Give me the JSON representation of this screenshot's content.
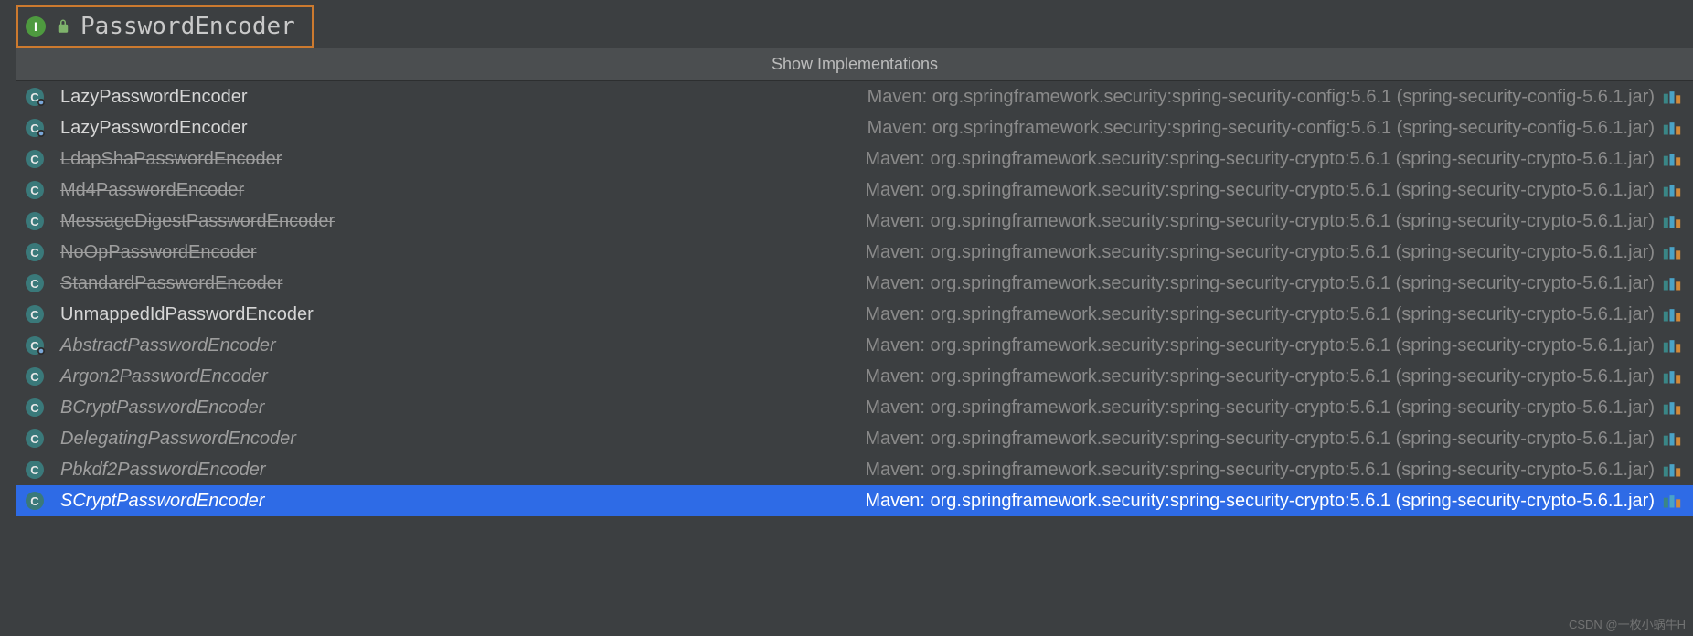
{
  "header": {
    "interface_name": "PasswordEncoder"
  },
  "popup": {
    "title": "Show Implementations"
  },
  "locations": {
    "config": "Maven: org.springframework.security:spring-security-config:5.6.1 (spring-security-config-5.6.1.jar)",
    "crypto": "Maven: org.springframework.security:spring-security-crypto:5.6.1 (spring-security-crypto-5.6.1.jar)"
  },
  "items": [
    {
      "name": "LazyPasswordEncoder",
      "style": "normal",
      "loc": "config",
      "selected": false,
      "overlay": true
    },
    {
      "name": "LazyPasswordEncoder",
      "style": "normal",
      "loc": "config",
      "selected": false,
      "overlay": true
    },
    {
      "name": "LdapShaPasswordEncoder",
      "style": "strike",
      "loc": "crypto",
      "selected": false,
      "overlay": false
    },
    {
      "name": "Md4PasswordEncoder",
      "style": "strike",
      "loc": "crypto",
      "selected": false,
      "overlay": false
    },
    {
      "name": "MessageDigestPasswordEncoder",
      "style": "strike",
      "loc": "crypto",
      "selected": false,
      "overlay": false
    },
    {
      "name": "NoOpPasswordEncoder",
      "style": "strike",
      "loc": "crypto",
      "selected": false,
      "overlay": false
    },
    {
      "name": "StandardPasswordEncoder",
      "style": "strike",
      "loc": "crypto",
      "selected": false,
      "overlay": false
    },
    {
      "name": "UnmappedIdPasswordEncoder",
      "style": "normal",
      "loc": "crypto",
      "selected": false,
      "overlay": false
    },
    {
      "name": "AbstractPasswordEncoder",
      "style": "italic",
      "loc": "crypto",
      "selected": false,
      "overlay": true
    },
    {
      "name": "Argon2PasswordEncoder",
      "style": "italic",
      "loc": "crypto",
      "selected": false,
      "overlay": false
    },
    {
      "name": "BCryptPasswordEncoder",
      "style": "italic",
      "loc": "crypto",
      "selected": false,
      "overlay": false
    },
    {
      "name": "DelegatingPasswordEncoder",
      "style": "italic",
      "loc": "crypto",
      "selected": false,
      "overlay": false
    },
    {
      "name": "Pbkdf2PasswordEncoder",
      "style": "italic",
      "loc": "crypto",
      "selected": false,
      "overlay": false
    },
    {
      "name": "SCryptPasswordEncoder",
      "style": "italic",
      "loc": "crypto",
      "selected": true,
      "overlay": false
    }
  ],
  "watermark": "CSDN @一枚小蜗牛H"
}
